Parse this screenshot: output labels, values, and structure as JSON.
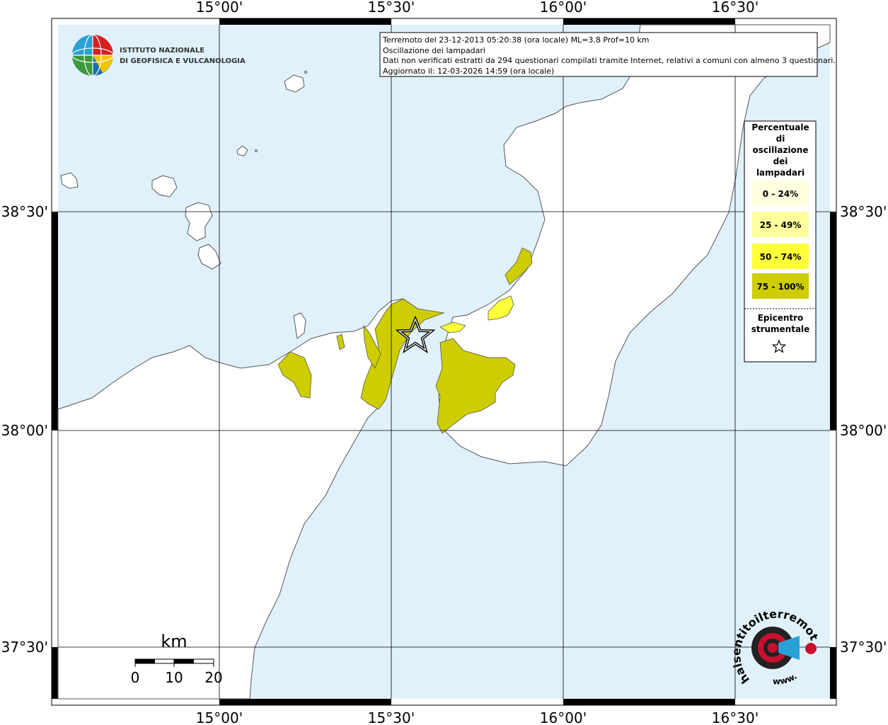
{
  "map": {
    "lon_ticks": [
      "15°00'",
      "15°30'",
      "16°00'",
      "16°30'"
    ],
    "lat_ticks": [
      "38°30'",
      "38°00'",
      "37°30'"
    ],
    "colors": {
      "sea": "#e0f1fc",
      "land": "#ffffff",
      "coast": "#555555"
    }
  },
  "institute": {
    "line1": "ISTITUTO NAZIONALE",
    "line2": "DI GEOFISICA E VULCANOLOGIA"
  },
  "info": {
    "line1": "Terremoto del 23-12-2013 05:20:38 (ora locale) ML=3.8 Prof=10 km",
    "line2": "Oscillazione dei lampadari",
    "line3": "Dati non verificati estratti da 294 questionari compilati tramite Internet, relativi a comuni con almeno 3 questionari.",
    "line4": "Aggiornato il: 12-03-2026 14:59 (ora locale)"
  },
  "legend": {
    "title": [
      "Percentuale",
      "di",
      "oscillazione",
      "dei",
      "lampadari"
    ],
    "classes": [
      {
        "label": "0 - 24%",
        "color": "#ffffe0"
      },
      {
        "label": "25 - 49%",
        "color": "#ffff9e"
      },
      {
        "label": "50 - 74%",
        "color": "#ffff3a"
      },
      {
        "label": "75 - 100%",
        "color": "#cdcd00"
      }
    ],
    "epicenter_title": [
      "Epicentro",
      "strumentale"
    ]
  },
  "scale": {
    "unit": "km",
    "labels": [
      "0",
      "10",
      "20"
    ]
  },
  "brand": {
    "name": "haisentitoilterremoto.it",
    "www": "www."
  }
}
